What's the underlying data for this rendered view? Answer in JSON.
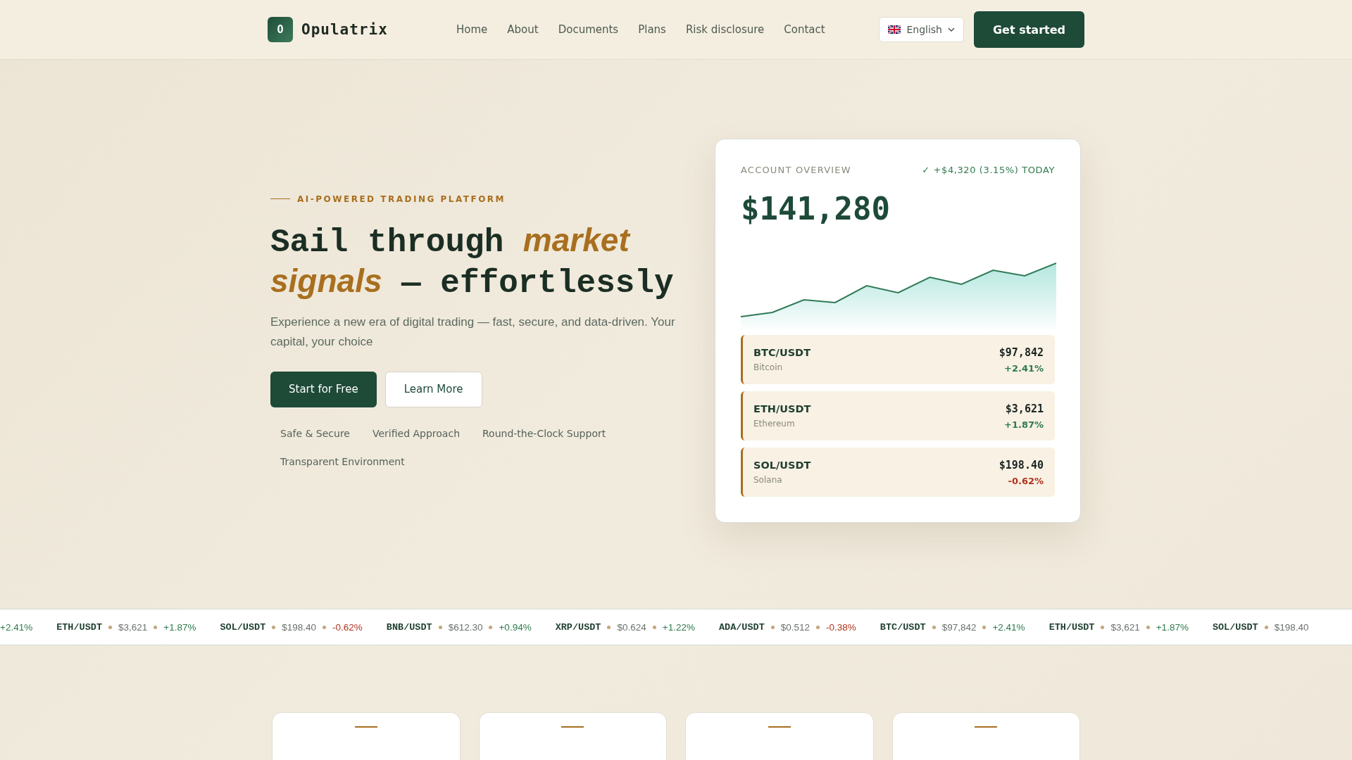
{
  "header": {
    "logo_letter": "O",
    "brand": "Opulatrix",
    "nav": [
      {
        "label": "Home"
      },
      {
        "label": "About"
      },
      {
        "label": "Documents"
      },
      {
        "label": "Plans"
      },
      {
        "label": "Risk disclosure"
      },
      {
        "label": "Contact"
      }
    ],
    "language": "English",
    "cta": "Get started"
  },
  "hero": {
    "eyebrow": "AI-POWERED TRADING PLATFORM",
    "headline": "Sail through *market signals* — effortlessly",
    "subtitle": "Experience a new era of digital trading — fast, secure, and data-driven. Your capital, your choice",
    "buttons": [
      {
        "label": "Start for Free",
        "kind": "primary"
      },
      {
        "label": "Learn More",
        "kind": "secondary"
      }
    ],
    "features": [
      "Safe & Secure",
      "Verified Approach",
      "Round-the-Clock Support",
      "Transparent Environment"
    ]
  },
  "account": {
    "title": "ACCOUNT OVERVIEW",
    "today": "✓ +$4,320 (3.15%) TODAY",
    "balance": "$141,280",
    "chart": {
      "kind": "sparkline"
    },
    "assets": [
      {
        "pair": "BTC/USDT",
        "name": "Bitcoin",
        "price": "$97,842",
        "change": "+2.41%",
        "color": "#2f7a4d"
      },
      {
        "pair": "ETH/USDT",
        "name": "Ethereum",
        "price": "$3,621",
        "change": "+1.87%",
        "color": "#2f7a4d"
      },
      {
        "pair": "SOL/USDT",
        "name": "Solana",
        "price": "$198.40",
        "change": "-0.62%",
        "color": "#b0331c"
      }
    ]
  },
  "ticker": [
    {
      "change": "+2.41%",
      "color": "#2f7a4d"
    },
    {
      "pair": "ETH/USDT",
      "price": "$3,621",
      "change": "+1.87%",
      "color": "#2f7a4d"
    },
    {
      "pair": "SOL/USDT",
      "price": "$198.40",
      "change": "-0.62%",
      "color": "#b0331c"
    },
    {
      "pair": "BNB/USDT",
      "price": "$612.30",
      "change": "+0.94%",
      "color": "#2f7a4d"
    },
    {
      "pair": "XRP/USDT",
      "price": "$0.624",
      "change": "+1.22%",
      "color": "#2f7a4d"
    },
    {
      "pair": "ADA/USDT",
      "price": "$0.512",
      "change": "-0.38%",
      "color": "#b0331c"
    },
    {
      "pair": "BTC/USDT",
      "price": "$97,842",
      "change": "+2.41%",
      "color": "#2f7a4d"
    },
    {
      "pair": "ETH/USDT",
      "price": "$3,621",
      "change": "+1.87%",
      "color": "#2f7a4d"
    },
    {
      "pair": "SOL/USDT",
      "price": "$198.40"
    }
  ],
  "feature_cards": [
    {
      "kind": "card"
    },
    {
      "kind": "card"
    },
    {
      "kind": "card"
    },
    {
      "kind": "card"
    }
  ]
}
